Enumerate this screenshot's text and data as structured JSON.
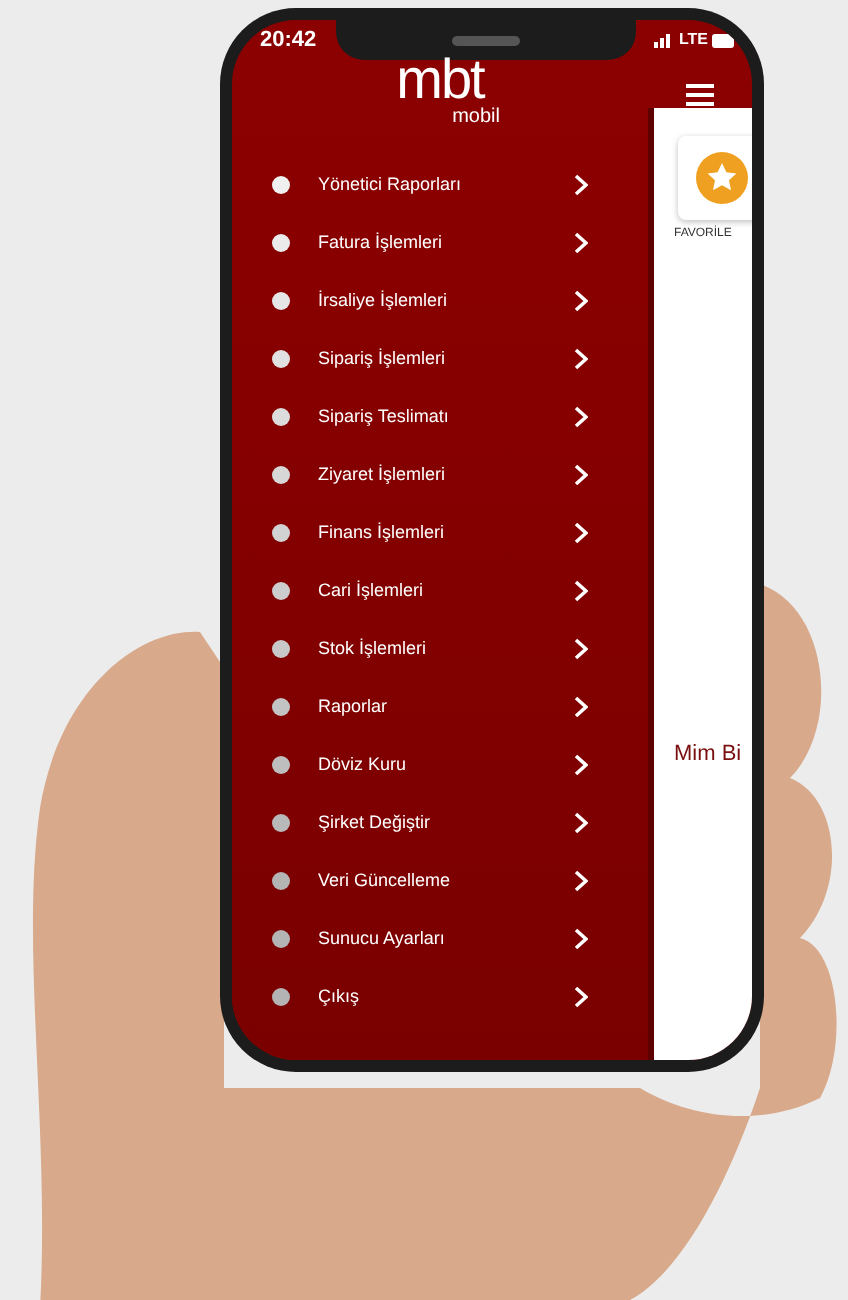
{
  "status_bar": {
    "time": "20:42",
    "network": "LTE"
  },
  "logo": {
    "name": "mbt",
    "subtitle": "mobil"
  },
  "menu": [
    {
      "label": "Yönetici Raporları"
    },
    {
      "label": "Fatura İşlemleri"
    },
    {
      "label": "İrsaliye İşlemleri"
    },
    {
      "label": "Sipariş İşlemleri"
    },
    {
      "label": "Sipariş Teslimatı"
    },
    {
      "label": "Ziyaret İşlemleri"
    },
    {
      "label": "Finans İşlemleri"
    },
    {
      "label": "Cari İşlemleri"
    },
    {
      "label": "Stok İşlemleri"
    },
    {
      "label": "Raporlar"
    },
    {
      "label": "Döviz Kuru"
    },
    {
      "label": "Şirket Değiştir"
    },
    {
      "label": "Veri Güncelleme"
    },
    {
      "label": "Sunucu Ayarları"
    },
    {
      "label": "Çıkış"
    }
  ],
  "panel": {
    "favorite_label": "FAVORİLE",
    "company_text": "Mim Bi"
  }
}
